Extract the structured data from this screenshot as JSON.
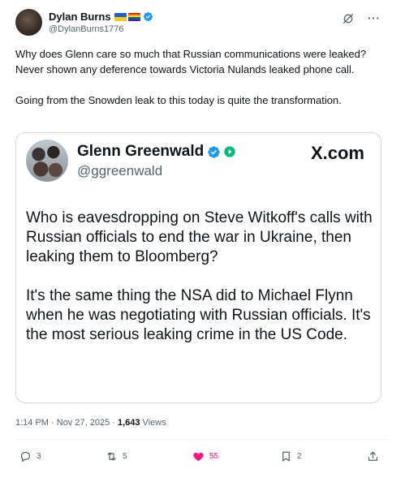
{
  "author": {
    "display_name": "Dylan Burns",
    "handle": "@DylanBurns1776"
  },
  "tweet": {
    "text": "Why does Glenn care so much that Russian communications were leaked? Never shown any deference towards Victoria Nulands leaked phone call.\n\nGoing from the Snowden leak to this today is quite the transformation."
  },
  "quoted": {
    "display_name": "Glenn Greenwald",
    "handle": "@ggreenwald",
    "brand": "X.com",
    "text": "Who is eavesdropping on Steve Witkoff's calls with Russian officials to end the war in Ukraine, then leaking them to Bloomberg?\n\nIt's the same thing the NSA did to Michael Flynn when he was negotiating with Russian officials. It's the most serious leaking crime in the US Code."
  },
  "meta": {
    "time": "1:14 PM",
    "separator": " · ",
    "date": "Nov 27, 2025",
    "views_count": "1,643",
    "views_label": " Views"
  },
  "actions": {
    "replies": "3",
    "reposts": "5",
    "likes": "55",
    "bookmarks": "2"
  },
  "colors": {
    "verified": "#1d9bf0",
    "like": "#f91880",
    "secondary_text": "#536471",
    "play_badge": "#00ba7c"
  }
}
